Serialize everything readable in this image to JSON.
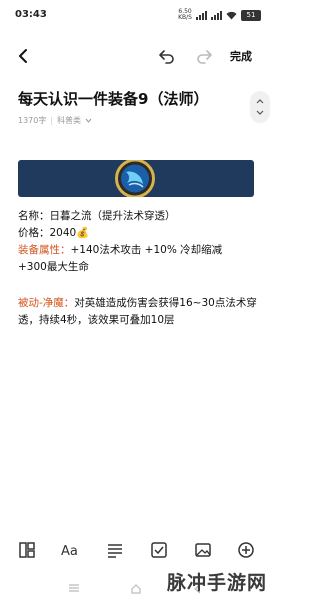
{
  "status_bar": {
    "time": "03:43",
    "net_speed_value": "6.50",
    "net_speed_unit": "KB/S",
    "battery": "51"
  },
  "toolbar": {
    "done_label": "完成"
  },
  "document": {
    "title": "每天认识一件装备9（法师）",
    "word_count": "1370字",
    "category": "科普类",
    "lines": [
      {
        "label": "名称：",
        "text": "日暮之流（提升法术穿透）"
      },
      {
        "label": "价格：",
        "text": "2040💰"
      },
      {
        "label": "装备属性：",
        "text": "+140法术攻击  +10% 冷却缩减"
      },
      {
        "label": "",
        "text": "+300最大生命"
      },
      {
        "label": "被动-净魔：",
        "text": "对英雄造成伤害会获得16~30点法术穿透，持续4秒，该效果可叠加10层"
      }
    ]
  },
  "watermark": "脉冲手游网",
  "icons": {
    "back": "chevron-left-icon",
    "undo": "undo-icon",
    "redo": "redo-icon",
    "expand": "chevron-updown-icon",
    "layout": "layout-icon",
    "text_style": "text-style-icon",
    "align": "align-icon",
    "checkbox": "checkbox-icon",
    "image": "image-icon",
    "add": "add-circle-icon"
  },
  "colors": {
    "accent": "#d4541e",
    "banner_bg": "#1f3a5c"
  }
}
